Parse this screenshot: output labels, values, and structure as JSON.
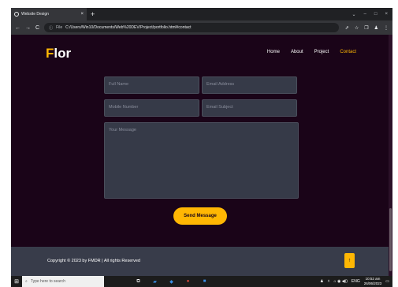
{
  "browser": {
    "tab_title": "Website Design",
    "tab_close": "×",
    "new_tab": "+",
    "minimize": "⌄",
    "minimize2": "–",
    "maximize": "□",
    "close": "×",
    "back": "←",
    "forward": "→",
    "reload": "C",
    "info": "ⓘ",
    "file_label": "File",
    "url": "C:/Users/Win10/Documents/Web%20DEV/Project/portfolio.html#contact",
    "share_icon": "⇗",
    "star_icon": "☆",
    "side_icon": "❐",
    "profile_icon": "♟",
    "menu_icon": "⋮"
  },
  "site": {
    "logo_first": "F",
    "logo_rest": "lor",
    "nav": [
      {
        "label": "Home"
      },
      {
        "label": "About"
      },
      {
        "label": "Project"
      },
      {
        "label": "Contact"
      }
    ],
    "accent_color": "#ffb703",
    "background_color": "#1a0418"
  },
  "form": {
    "name_placeholder": "Full Name",
    "email_placeholder": "Email Address",
    "mobile_placeholder": "Mobile Number",
    "subject_placeholder": "Email Subject",
    "message_placeholder": "Your Message",
    "send_label": "Send Message"
  },
  "footer": {
    "copyright": "Copyright © 2023 by FMDR | All rights Reserved",
    "to_top_icon": "↑"
  },
  "taskbar": {
    "start_icon": "⊞",
    "search_icon": "⌕",
    "search_placeholder": "Type here to search",
    "task_view_icon": "⧉",
    "explorer_icon": "▰",
    "vscode_icon": "◆",
    "chrome_icon": "●",
    "app_icon": "■",
    "tray_user": "♟",
    "tray_up": "˄",
    "tray_icons": "⌂ ◉ ◀))",
    "lang": "ENG",
    "time": "10:52 am",
    "date": "26/06/2023",
    "notif_icon": "▭"
  }
}
